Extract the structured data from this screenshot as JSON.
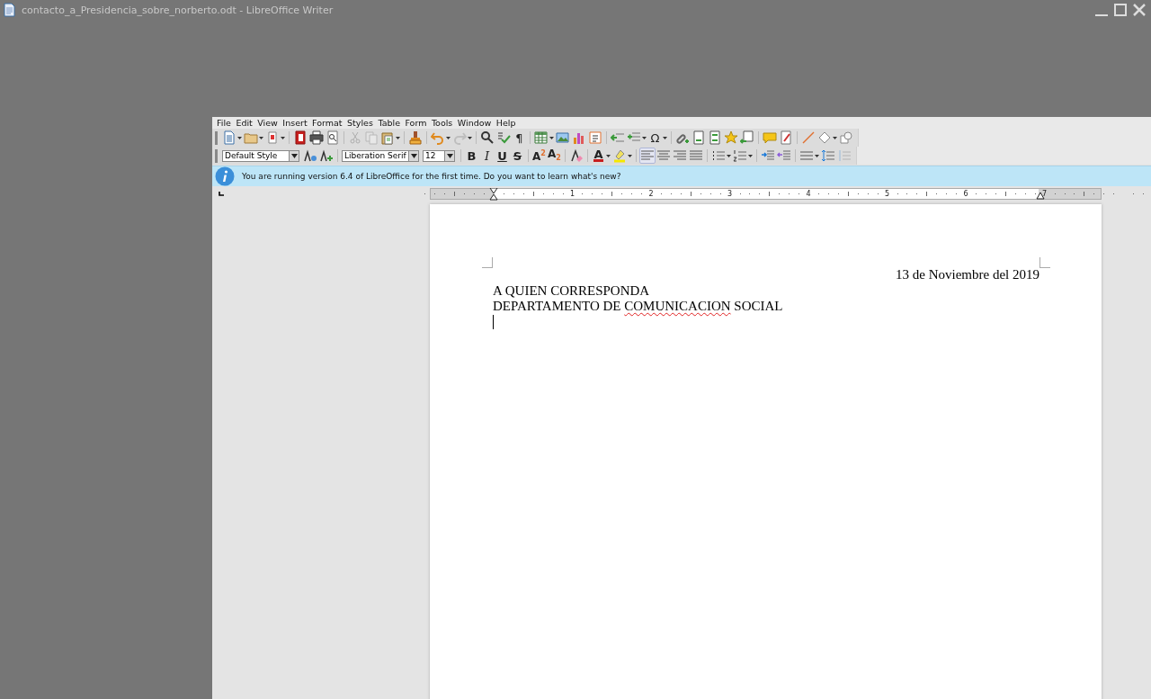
{
  "window": {
    "title": "contacto_a_Presidencia_sobre_norberto.odt - LibreOffice Writer"
  },
  "menu": [
    "File",
    "Edit",
    "View",
    "Insert",
    "Format",
    "Styles",
    "Table",
    "Form",
    "Tools",
    "Window",
    "Help"
  ],
  "standard_toolbar": [
    {
      "kind": "new",
      "dropdown": true,
      "disabled": false
    },
    {
      "kind": "open",
      "dropdown": true,
      "disabled": false
    },
    {
      "kind": "save",
      "dropdown": true,
      "disabled": false
    },
    {
      "kind": "separator"
    },
    {
      "kind": "pdf",
      "dropdown": false,
      "disabled": false
    },
    {
      "kind": "print",
      "dropdown": false,
      "disabled": false
    },
    {
      "kind": "preview",
      "dropdown": false,
      "disabled": false
    },
    {
      "kind": "separator"
    },
    {
      "kind": "cut",
      "dropdown": false,
      "disabled": true
    },
    {
      "kind": "copy",
      "dropdown": false,
      "disabled": true
    },
    {
      "kind": "paste",
      "dropdown": true,
      "disabled": false
    },
    {
      "kind": "separator"
    },
    {
      "kind": "clone",
      "dropdown": false,
      "disabled": false
    },
    {
      "kind": "separator"
    },
    {
      "kind": "undo",
      "dropdown": true,
      "disabled": false
    },
    {
      "kind": "redo",
      "dropdown": true,
      "disabled": true
    },
    {
      "kind": "separator"
    },
    {
      "kind": "find",
      "dropdown": false,
      "disabled": false
    },
    {
      "kind": "spell",
      "dropdown": false,
      "disabled": false
    },
    {
      "kind": "glyph",
      "glyph": "¶",
      "dropdown": false,
      "disabled": false
    },
    {
      "kind": "separator"
    },
    {
      "kind": "table",
      "dropdown": true,
      "disabled": false
    },
    {
      "kind": "image",
      "dropdown": false,
      "disabled": false
    },
    {
      "kind": "chart",
      "dropdown": false,
      "disabled": false
    },
    {
      "kind": "textbox",
      "dropdown": false,
      "disabled": false
    },
    {
      "kind": "separator"
    },
    {
      "kind": "pagebreak",
      "dropdown": false,
      "disabled": false
    },
    {
      "kind": "field",
      "dropdown": true,
      "disabled": false
    },
    {
      "kind": "glyph",
      "glyph": "Ω",
      "dropdown": true,
      "disabled": false
    },
    {
      "kind": "separator"
    },
    {
      "kind": "hyperlink",
      "dropdown": false,
      "disabled": false
    },
    {
      "kind": "footnote",
      "dropdown": false,
      "disabled": false
    },
    {
      "kind": "endnote",
      "dropdown": false,
      "disabled": false
    },
    {
      "kind": "bookmark",
      "dropdown": false,
      "disabled": false
    },
    {
      "kind": "crossref",
      "dropdown": false,
      "disabled": false
    },
    {
      "kind": "separator"
    },
    {
      "kind": "comment",
      "dropdown": false,
      "disabled": false
    },
    {
      "kind": "track",
      "dropdown": false,
      "disabled": false
    },
    {
      "kind": "separator"
    },
    {
      "kind": "line",
      "dropdown": false,
      "disabled": false
    },
    {
      "kind": "shapes",
      "dropdown": true,
      "disabled": false
    },
    {
      "kind": "basicshapes",
      "dropdown": false,
      "disabled": false
    }
  ],
  "formatting_toolbar": [
    {
      "kind": "stylecombo",
      "value": "Default Style"
    },
    {
      "kind": "updatestyle",
      "dropdown": false,
      "disabled": false
    },
    {
      "kind": "newstyle",
      "dropdown": false,
      "disabled": false
    },
    {
      "kind": "separator"
    },
    {
      "kind": "fontcombo",
      "value": "Liberation Serif"
    },
    {
      "kind": "sizecombo",
      "value": "12"
    },
    {
      "kind": "separator"
    },
    {
      "kind": "bold",
      "glyph": "B",
      "dropdown": false,
      "disabled": false
    },
    {
      "kind": "italic",
      "glyph": "I",
      "dropdown": false,
      "disabled": false
    },
    {
      "kind": "underline",
      "glyph": "U",
      "dropdown": false,
      "disabled": false
    },
    {
      "kind": "strike",
      "glyph": "S",
      "dropdown": false,
      "disabled": false
    },
    {
      "kind": "separator"
    },
    {
      "kind": "superscript",
      "glyph": "A$^{2}$",
      "dropdown": false,
      "disabled": false
    },
    {
      "kind": "subscript",
      "glyph": "A$_{2}$",
      "dropdown": false,
      "disabled": false
    },
    {
      "kind": "separator"
    },
    {
      "kind": "clearformat",
      "dropdown": false,
      "disabled": false
    },
    {
      "kind": "separator"
    },
    {
      "kind": "fontcolor",
      "glyph": "A",
      "dropdown": true,
      "disabled": false
    },
    {
      "kind": "highlight",
      "dropdown": true,
      "disabled": false
    },
    {
      "kind": "separator"
    },
    {
      "kind": "alignleft",
      "dropdown": false,
      "disabled": false,
      "selected": true
    },
    {
      "kind": "aligncenter",
      "dropdown": false,
      "disabled": false,
      "selected": false
    },
    {
      "kind": "alignright",
      "dropdown": false,
      "disabled": false,
      "selected": false
    },
    {
      "kind": "justify",
      "dropdown": false,
      "disabled": false,
      "selected": false
    },
    {
      "kind": "separator"
    },
    {
      "kind": "bullets",
      "dropdown": true,
      "disabled": false
    },
    {
      "kind": "numbering",
      "dropdown": true,
      "disabled": false
    },
    {
      "kind": "separator"
    },
    {
      "kind": "indentinc",
      "dropdown": false,
      "disabled": false
    },
    {
      "kind": "indentdec",
      "dropdown": false,
      "disabled": false
    },
    {
      "kind": "separator"
    },
    {
      "kind": "spacing",
      "dropdown": true,
      "disabled": false
    },
    {
      "kind": "parainc",
      "dropdown": false,
      "disabled": false
    },
    {
      "kind": "paradec",
      "dropdown": false,
      "disabled": true
    }
  ],
  "infobar": {
    "message": "You are running version 6.4 of LibreOffice for the first time. Do you want to learn what's new?"
  },
  "ruler": {
    "labels": [
      "1",
      "2",
      "3",
      "4",
      "5",
      "6",
      "7"
    ]
  },
  "document": {
    "paragraphs": [
      {
        "right_aligned": true,
        "runs": [
          {
            "text": "13 de Noviembre del 2019",
            "misspelled": false
          }
        ]
      },
      {
        "right_aligned": false,
        "runs": [
          {
            "text": "A QUIEN CORRESPONDA",
            "misspelled": false
          }
        ]
      },
      {
        "right_aligned": false,
        "runs": [
          {
            "text": "DEPARTAMENTO DE ",
            "misspelled": false
          },
          {
            "text": "COMUNICACION",
            "misspelled": true
          },
          {
            "text": " SOCIAL",
            "misspelled": false
          }
        ]
      },
      {
        "right_aligned": false,
        "cursor": true
      }
    ]
  }
}
